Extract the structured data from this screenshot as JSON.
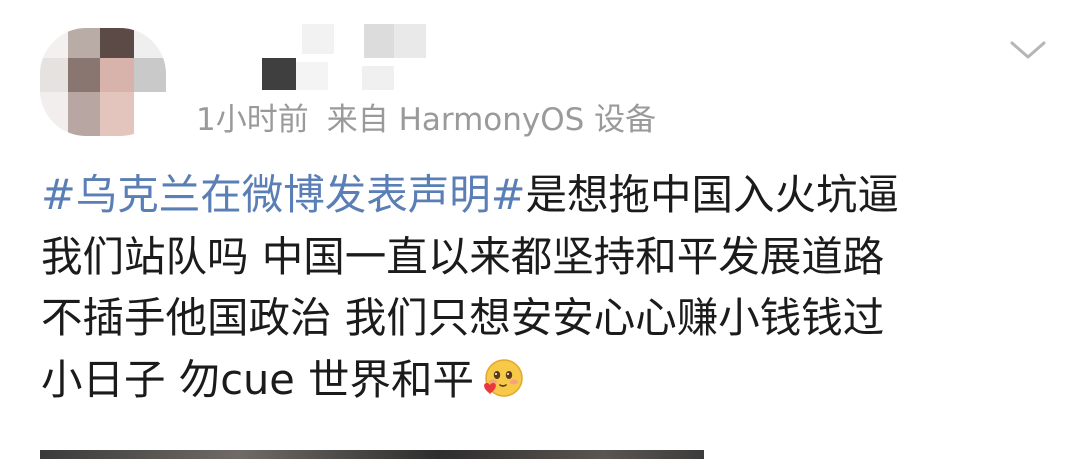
{
  "post": {
    "time": "1小时前",
    "source": "来自 HarmonyOS 设备",
    "topic": "#乌克兰在微博发表声明#",
    "line1_rest": "是想拖中国入火坑逼",
    "line2": "我们站队吗 中国一直以来都坚持和平发展道路",
    "line3": "不插手他国政治 我们只想安安心心赚小钱钱过",
    "line4": "小日子 勿cue 世界和平",
    "emoji": "blushing-heart-emoji"
  },
  "icons": {
    "menu": "chevron-down-icon"
  },
  "colors": {
    "topic_link": "#5a7eb6",
    "meta_text": "#9a9a9a",
    "body_text": "#1b1b1b"
  }
}
